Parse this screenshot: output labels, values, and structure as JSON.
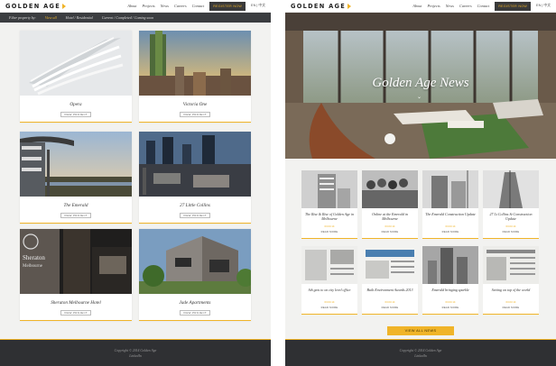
{
  "nav": {
    "logo": "GOLDEN AGE",
    "items": [
      "About",
      "Projects",
      "News",
      "Careers",
      "Contact"
    ],
    "register": "REGISTER NOW",
    "lang": "EN | 中文"
  },
  "projects_page": {
    "filter": {
      "label": "Filter property by:",
      "options": [
        "View all",
        "Hotel / Residential",
        "Current / Completed / Coming soon"
      ]
    },
    "cards": [
      {
        "name": "Opera",
        "button": "VIEW PROJECT"
      },
      {
        "name": "Victoria One",
        "button": "VIEW PROJECT"
      },
      {
        "name": "The Emerald",
        "button": "VIEW PROJECT"
      },
      {
        "name": "27 Little Collins",
        "button": "VIEW PROJECT"
      },
      {
        "name": "Sheraton Melbourne Hotel",
        "button": "VIEW PROJECT"
      },
      {
        "name": "Jade Apartments",
        "button": "VIEW PROJECT"
      }
    ],
    "footer": {
      "copyright": "Copyright © 2014 Golden Age",
      "link": "LinkedIn"
    }
  },
  "news_page": {
    "hero_title": "Golden Age News",
    "items": [
      {
        "title": "The Rise & Rise of Golden Age in Melbourne",
        "date": "03.03.14",
        "link": "READ MORE"
      },
      {
        "title": "Online at the Emerald in Melbourne",
        "date": "03.03.14",
        "link": "READ MORE"
      },
      {
        "title": "The Emerald Construction Update",
        "date": "03.03.14",
        "link": "READ MORE"
      },
      {
        "title": "27 Lt Collins St Construction Update",
        "date": "03.03.14",
        "link": "READ MORE"
      },
      {
        "title": "Sth gets to on city level office",
        "date": "03.03.14",
        "link": "READ MORE"
      },
      {
        "title": "Built Environment Awards 2013",
        "date": "03.03.14",
        "link": "READ MORE"
      },
      {
        "title": "Emerald bringing sparkle",
        "date": "03.03.14",
        "link": "READ MORE"
      },
      {
        "title": "Setting on top of the world",
        "date": "03.03.14",
        "link": "READ MORE"
      }
    ],
    "view_all": "VIEW ALL NEWS",
    "footer": {
      "copyright": "Copyright © 2014 Golden Age",
      "link": "LinkedIn"
    }
  },
  "colors": {
    "accent": "#f0b428",
    "dark": "#3b3d40",
    "footer": "#2f3033"
  }
}
